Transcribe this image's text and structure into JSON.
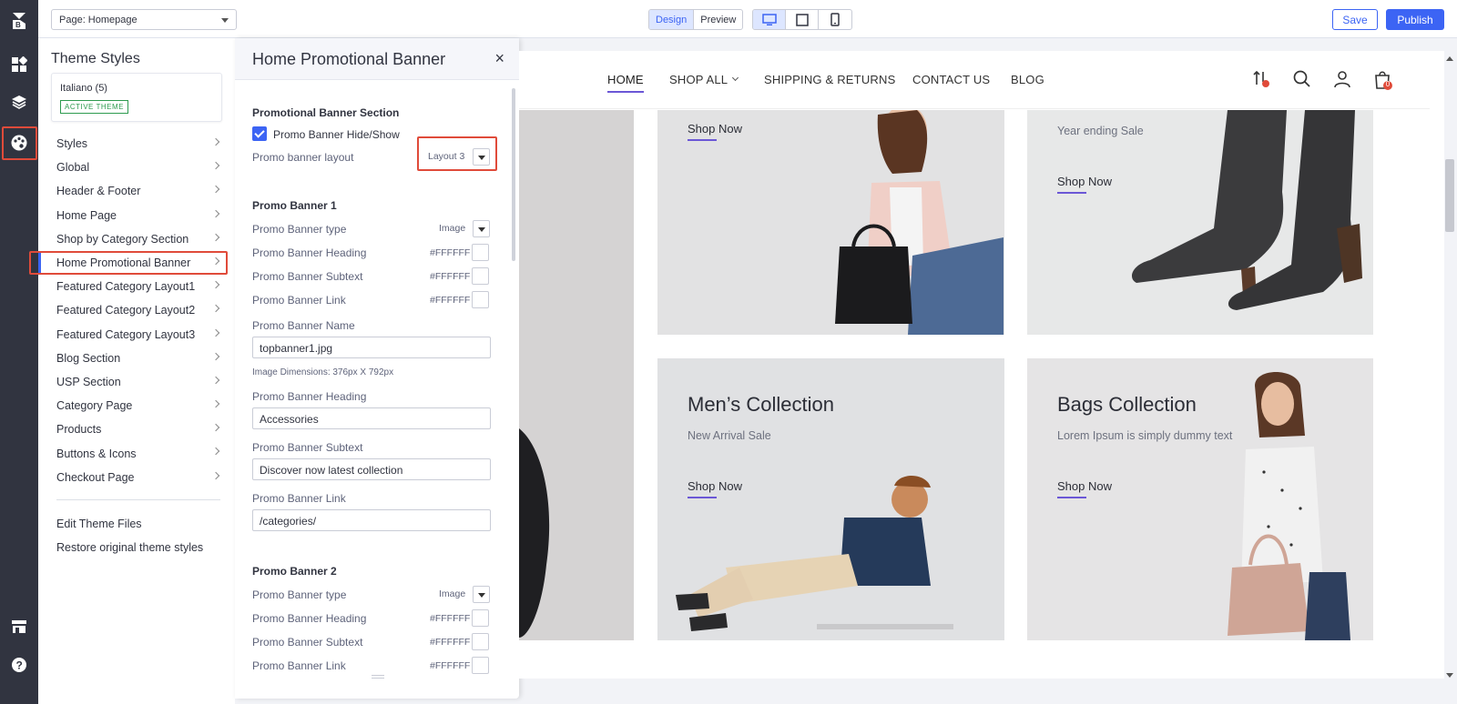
{
  "topbar": {
    "page_select": "Page: Homepage",
    "mode_design": "Design",
    "mode_preview": "Preview",
    "save": "Save",
    "publish": "Publish"
  },
  "sidebar": {
    "title": "Theme Styles",
    "theme_name": "Italiano (5)",
    "theme_badge": "ACTIVE THEME",
    "items": [
      "Styles",
      "Global",
      "Header & Footer",
      "Home Page",
      "Shop by Category Section",
      "Home Promotional Banner",
      "Featured Category Layout1",
      "Featured Category Layout2",
      "Featured Category Layout3",
      "Blog Section",
      "USP Section",
      "Category Page",
      "Products",
      "Buttons & Icons",
      "Checkout Page"
    ],
    "edit_files": "Edit Theme Files",
    "restore": "Restore original theme styles"
  },
  "panel": {
    "title": "Home Promotional Banner",
    "close": "×",
    "section_title": "Promotional Banner Section",
    "hide_show_label": "Promo Banner Hide/Show",
    "layout_label": "Promo banner layout",
    "layout_value": "Layout 3",
    "banner1": {
      "title": "Promo Banner 1",
      "type_label": "Promo Banner type",
      "type_value": "Image",
      "heading_color_label": "Promo Banner Heading",
      "heading_color": "#FFFFFF",
      "subtext_color_label": "Promo Banner Subtext",
      "subtext_color": "#FFFFFF",
      "link_color_label": "Promo Banner Link",
      "link_color": "#FFFFFF",
      "name_label": "Promo Banner Name",
      "name_value": "topbanner1.jpg",
      "dimensions": "Image Dimensions: 376px X 792px",
      "heading_label": "Promo Banner Heading",
      "heading_value": "Accessories",
      "subtext_label": "Promo Banner Subtext",
      "subtext_value": "Discover now latest collection",
      "link_label": "Promo Banner Link",
      "link_value": "/categories/"
    },
    "banner2": {
      "title": "Promo Banner 2",
      "type_label": "Promo Banner type",
      "type_value": "Image",
      "heading_color_label": "Promo Banner Heading",
      "heading_color": "#FFFFFF",
      "subtext_color_label": "Promo Banner Subtext",
      "subtext_color": "#FFFFFF",
      "link_color_label": "Promo Banner Link",
      "link_color": "#FFFFFF"
    }
  },
  "preview": {
    "nav": [
      "HOME",
      "SHOP ALL",
      "SHIPPING & RETURNS",
      "CONTACT US",
      "BLOG"
    ],
    "cart_count": "0",
    "cards": [
      {
        "heading": "",
        "subtext": "",
        "link": "Shop Now"
      },
      {
        "heading": "",
        "subtext": "Year ending Sale",
        "link": "Shop Now"
      },
      {
        "heading": "Men’s Collection",
        "subtext": "New Arrival Sale",
        "link": "Shop Now"
      },
      {
        "heading": "Bags Collection",
        "subtext": "Lorem Ipsum is simply dummy text",
        "link": "Shop Now"
      }
    ]
  },
  "colors": {
    "accent": "#3c64f4",
    "highlight": "#e04b3a",
    "rail": "#313440",
    "nav_underline": "#6b57d6"
  }
}
